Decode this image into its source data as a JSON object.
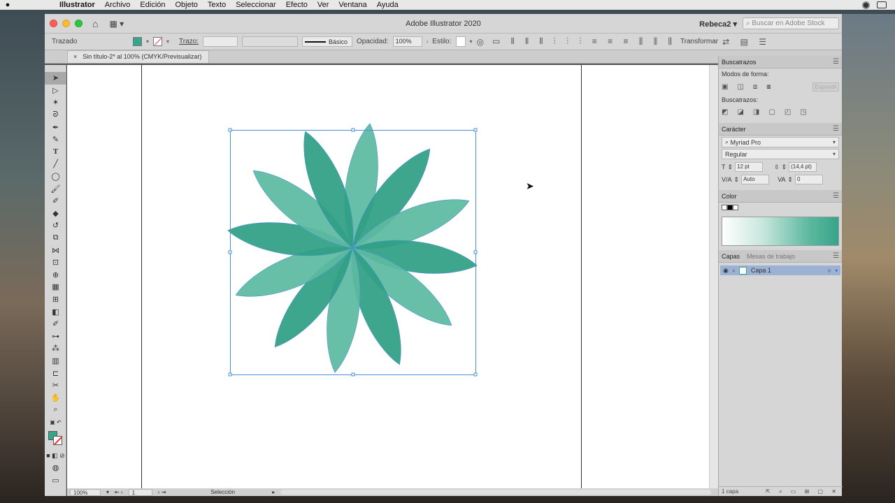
{
  "mac_menu": {
    "apple": "",
    "items": [
      "Illustrator",
      "Archivo",
      "Edición",
      "Objeto",
      "Texto",
      "Seleccionar",
      "Efecto",
      "Ver",
      "Ventana",
      "Ayuda"
    ]
  },
  "window": {
    "title": "Adobe Illustrator 2020",
    "user": "Rebeca2",
    "stock_placeholder": "Buscar en Adobe Stock"
  },
  "control_bar": {
    "mode_label": "Trazado",
    "stroke_label": "Trazo:",
    "stroke_style": "Básico",
    "opacity_label": "Opacidad:",
    "opacity_value": "100%",
    "style_label": "Estilo:",
    "transform_label": "Transformar",
    "fill_color": "#36a58a"
  },
  "document_tab": {
    "close": "×",
    "title": "Sin título-2* al 100% (CMYK/Previsualizar)"
  },
  "tools": [
    "selection-tool",
    "direct-selection-tool",
    "magic-wand-tool",
    "lasso-tool",
    "pen-tool",
    "curvature-tool",
    "type-tool",
    "line-tool",
    "ellipse-tool",
    "paintbrush-tool",
    "shaper-tool",
    "eraser-tool",
    "rotate-tool",
    "scale-tool",
    "width-tool",
    "free-transform-tool",
    "shape-builder-tool",
    "perspective-tool",
    "mesh-tool",
    "gradient-tool",
    "eyedropper-tool",
    "blend-tool",
    "symbol-sprayer-tool",
    "column-graph-tool",
    "artboard-tool",
    "slice-tool",
    "hand-tool",
    "zoom-tool"
  ],
  "status_bar": {
    "zoom": "100%",
    "artboard": "1",
    "tool": "Selección"
  },
  "panels": {
    "pathfinder": {
      "title": "Buscatrazos",
      "shape_modes": "Modos de forma:",
      "expand": "Expandir",
      "pathfinders": "Buscatrazos:"
    },
    "character": {
      "title": "Carácter",
      "font": "Myriad Pro",
      "style": "Regular",
      "size": "12 pt",
      "leading": "(14,4 pt)",
      "kerning": "Auto",
      "tracking": "0"
    },
    "color": {
      "title": "Color",
      "gradient_start": "#ffffff",
      "gradient_end": "#36a58a"
    },
    "layers": {
      "tab_layers": "Capas",
      "tab_artboards": "Mesas de trabajo",
      "layer_name": "Capa 1",
      "count": "1 capa"
    }
  },
  "artwork": {
    "petal_dark": "#2e9e82",
    "petal_light": "#5bbaa0",
    "petal_center": "#1e8a6a",
    "selection_color": "#4a90d9"
  }
}
